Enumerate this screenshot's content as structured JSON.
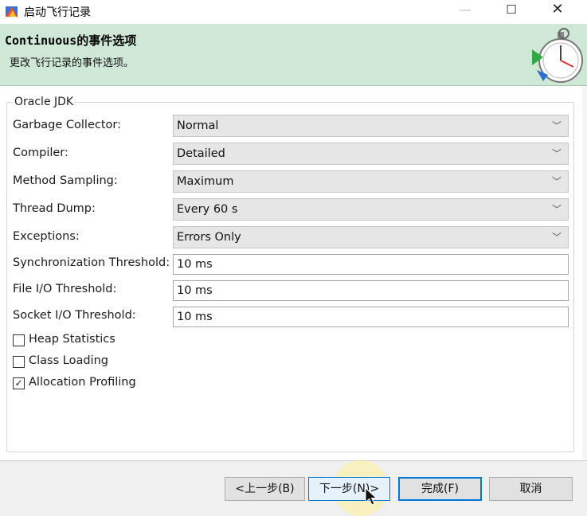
{
  "window": {
    "title": "启动飞行记录",
    "minimize_glyph": "—",
    "maximize_glyph": "☐",
    "close_glyph": "✕"
  },
  "banner": {
    "title": "Continuous的事件选项",
    "subtitle": "更改飞行记录的事件选项。"
  },
  "group": {
    "legend": "Oracle JDK"
  },
  "settings": {
    "garbage_collector": {
      "label": "Garbage Collector:",
      "value": "Normal"
    },
    "compiler": {
      "label": "Compiler:",
      "value": "Detailed"
    },
    "method_sampling": {
      "label": "Method Sampling:",
      "value": "Maximum"
    },
    "thread_dump": {
      "label": "Thread Dump:",
      "value": "Every 60 s"
    },
    "exceptions": {
      "label": "Exceptions:",
      "value": "Errors Only"
    },
    "sync_threshold": {
      "label": "Synchronization Threshold:",
      "value": "10 ms"
    },
    "file_io_threshold": {
      "label": "File I/O Threshold:",
      "value": "10 ms"
    },
    "socket_io_threshold": {
      "label": "Socket I/O Threshold:",
      "value": "10 ms"
    }
  },
  "checkboxes": {
    "heap_statistics": {
      "label": "Heap Statistics",
      "checked": false
    },
    "class_loading": {
      "label": "Class Loading",
      "checked": false
    },
    "allocation_profiling": {
      "label": "Allocation Profiling",
      "checked": true,
      "mark": "✓"
    }
  },
  "buttons": {
    "back": "<上一步(B)",
    "next": "下一步(N)>",
    "finish": "完成(F)",
    "cancel": "取消"
  },
  "icons": {
    "chevron": "﹀"
  },
  "colors": {
    "banner_bg": "#cfe8d6",
    "focus_border": "#0078d7"
  }
}
